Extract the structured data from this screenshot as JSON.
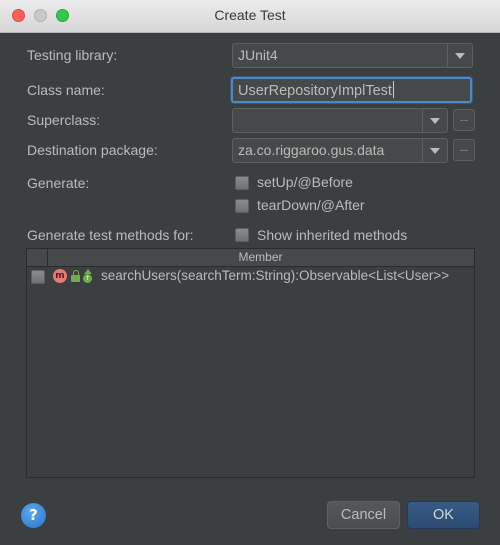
{
  "window": {
    "title": "Create Test"
  },
  "form": {
    "testing_library": {
      "label": "Testing library:",
      "value": "JUnit4"
    },
    "class_name": {
      "label": "Class name:",
      "value": "UserRepositoryImplTest"
    },
    "superclass": {
      "label": "Superclass:",
      "value": "",
      "browse_label": "..."
    },
    "destination_package": {
      "label": "Destination package:",
      "value": "za.co.riggaroo.gus.data",
      "browse_label": "..."
    },
    "generate": {
      "label": "Generate:",
      "setup_label": "setUp/@Before",
      "setup_checked": false,
      "teardown_label": "tearDown/@After",
      "teardown_checked": false
    },
    "methods_for": {
      "label": "Generate test methods for:",
      "inherited_label": "Show inherited methods",
      "inherited_checked": false
    }
  },
  "members_table": {
    "header": "Member",
    "rows": [
      {
        "checked": false,
        "icon_letter": "m",
        "icons": [
          "method-icon",
          "unlocked-icon",
          "override-icon"
        ],
        "signature": "searchUsers(searchTerm:String):Observable<List<User>>"
      }
    ]
  },
  "footer": {
    "help_label": "?",
    "cancel_label": "Cancel",
    "ok_label": "OK"
  },
  "colors": {
    "background": "#3c3f41",
    "focus_border": "#4a88c7",
    "ok_button": "#375b84",
    "text": "#bbbbbb"
  }
}
